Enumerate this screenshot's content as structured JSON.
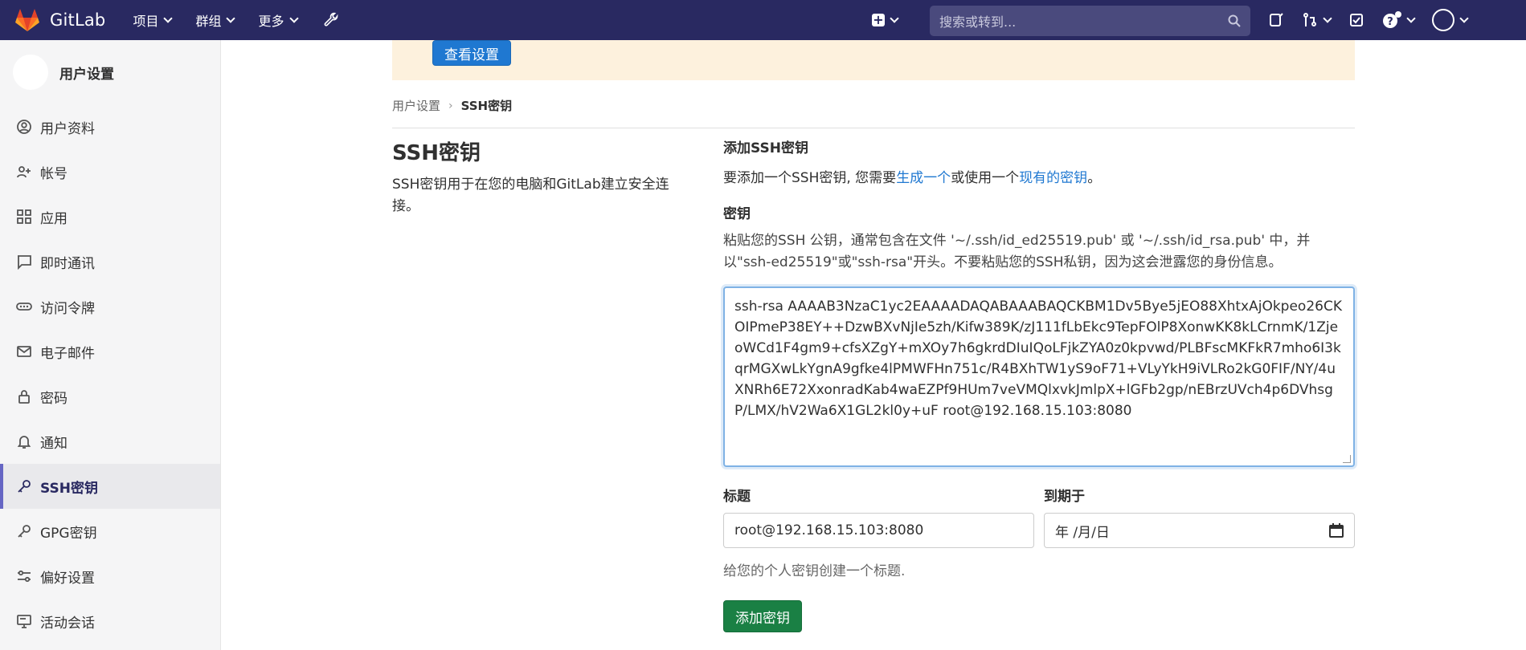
{
  "topbar": {
    "brand": "GitLab",
    "menu": [
      "项目",
      "群组",
      "更多"
    ],
    "search_placeholder": "搜索或转到..."
  },
  "sidebar": {
    "title": "用户设置",
    "items": [
      {
        "label": "用户资料",
        "icon": "user-circle-icon"
      },
      {
        "label": "帐号",
        "icon": "account-icon"
      },
      {
        "label": "应用",
        "icon": "applications-icon"
      },
      {
        "label": "即时通讯",
        "icon": "chat-icon"
      },
      {
        "label": "访问令牌",
        "icon": "token-icon"
      },
      {
        "label": "电子邮件",
        "icon": "mail-icon"
      },
      {
        "label": "密码",
        "icon": "lock-icon"
      },
      {
        "label": "通知",
        "icon": "bell-icon"
      },
      {
        "label": "SSH密钥",
        "icon": "key-icon",
        "active": true
      },
      {
        "label": "GPG密钥",
        "icon": "key-icon"
      },
      {
        "label": "偏好设置",
        "icon": "preferences-icon"
      },
      {
        "label": "活动会话",
        "icon": "monitor-icon"
      }
    ]
  },
  "banner": {
    "button_label": "查看设置"
  },
  "breadcrumb": {
    "parent": "用户设置",
    "current": "SSH密钥"
  },
  "page": {
    "title": "SSH密钥",
    "description": "SSH密钥用于在您的电脑和GitLab建立安全连接。"
  },
  "form": {
    "add_heading": "添加SSH密钥",
    "add_desc_prefix": "要添加一个SSH密钥, 您需要",
    "generate_link": "生成一个",
    "add_desc_mid": "或使用一个",
    "existing_link": "现有的密钥",
    "add_desc_suffix": "。",
    "key_label": "密钥",
    "key_help": "粘贴您的SSH 公钥，通常包含在文件 '~/.ssh/id_ed25519.pub' 或 '~/.ssh/id_rsa.pub' 中，并以\"ssh-ed25519\"或\"ssh-rsa\"开头。不要粘贴您的SSH私钥，因为这会泄露您的身份信息。",
    "key_value": "ssh-rsa AAAAB3NzaC1yc2EAAAADAQABAAABAQCKBM1Dv5Bye5jEO88XhtxAjOkpeo26CKOIPmeP38EY++DzwBXvNjIe5zh/Kifw389K/zJ111fLbEkc9TepFOlP8XonwKK8kLCrnmK/1ZjeoWCd1F4gm9+cfsXZgY+mXOy7h6gkrdDIuIQoLFjkZYA0z0kpvwd/PLBFscMKFkR7mho6I3kqrMGXwLkYgnA9gfke4lPMWFHn751c/R4BXhTW1yS9oF71+VLyYkH9iVLRo2kG0FIF/NY/4uXNRh6E72XxonradKab4waEZPf9HUm7veVMQlxvkJmlpX+lGFb2gp/nEBrzUVch4p6DVhsgP/LMX/hV2Wa6X1GL2kl0y+uF root@192.168.15.103:8080",
    "title_label": "标题",
    "title_value": "root@192.168.15.103:8080",
    "expires_label": "到期于",
    "expires_value": "年 /月/日",
    "title_hint": "给您的个人密钥创建一个标题.",
    "submit_label": "添加密钥"
  }
}
